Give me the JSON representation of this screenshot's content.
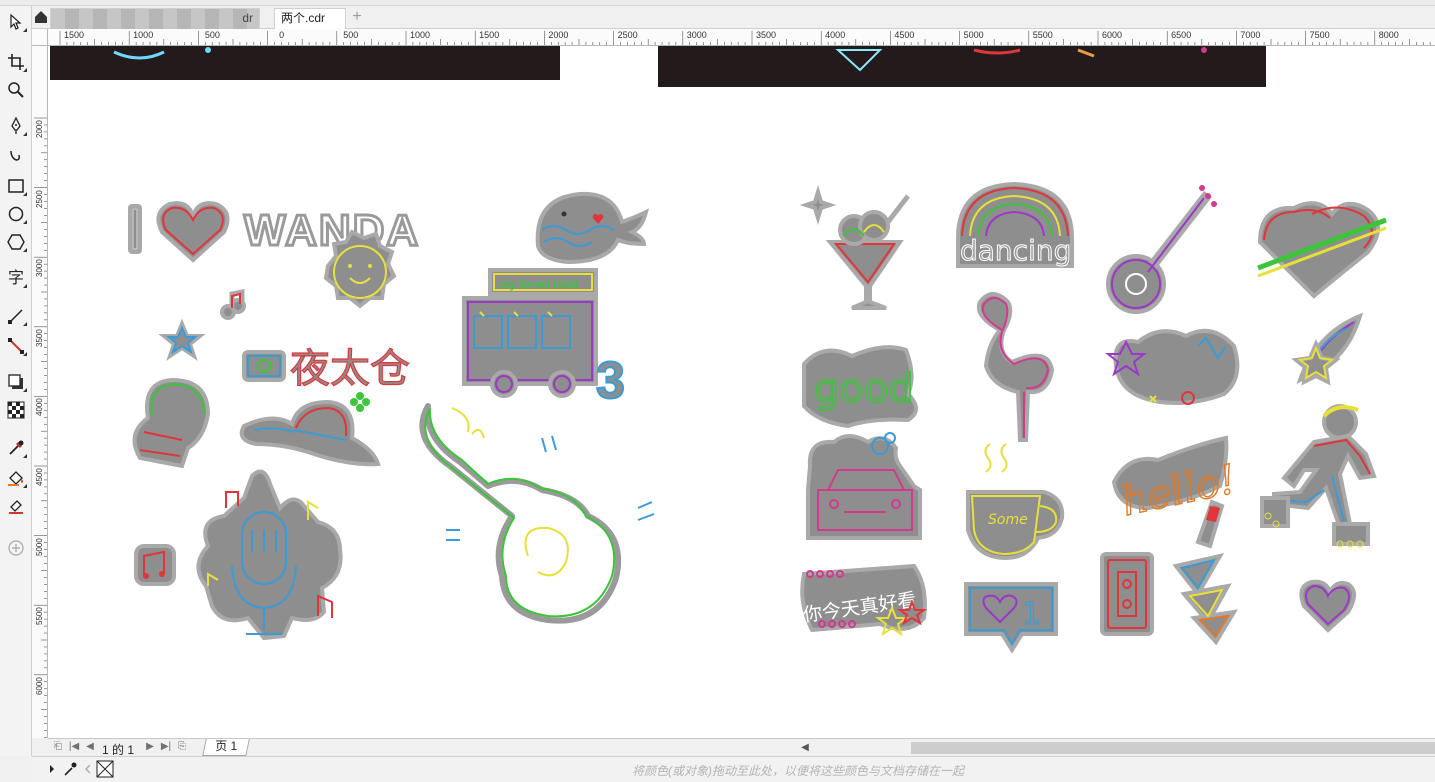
{
  "tabs": [
    {
      "label": "dr",
      "active": false,
      "blurred": true
    },
    {
      "label": "两个.cdr",
      "active": true,
      "blurred": false
    }
  ],
  "tab_add_label": "+",
  "ruler": {
    "h_labels": [
      "1500",
      "1000",
      "500",
      "0",
      "500",
      "1000",
      "1500",
      "2000",
      "2500",
      "3000",
      "3500",
      "4000",
      "4500",
      "5000",
      "5500",
      "6000",
      "6500",
      "7000",
      "7500",
      "8000"
    ],
    "v_labels": [
      "2000",
      "2500",
      "3000",
      "3500",
      "4000",
      "4500",
      "5000",
      "5500",
      "6000"
    ]
  },
  "canvas": {
    "wanda_text": "WANDA",
    "i_text": "I",
    "bus_sign": "my Street Hold",
    "ye_tai_cang": "夜太仓",
    "dancing_text": "dancing",
    "good_text": "good",
    "hello_text": "hello!",
    "some_text": "Some",
    "sticker_text": "你今天真好看",
    "like_count": "1",
    "bus_number": "3"
  },
  "page_nav": {
    "page_count": "1 的 1",
    "page_tab": "页 1"
  },
  "status": {
    "hint": "将颜色(或对象)拖动至此处，以便将这些颜色与文档存储在一起"
  },
  "colors": {
    "neon_red": "#e0353a",
    "neon_yellow": "#e8e03a",
    "neon_blue": "#3a9bd6",
    "neon_green": "#3cc43a",
    "neon_purple": "#9b38c8",
    "neon_pink": "#d23a8e",
    "neon_orange": "#e07a2a",
    "sticker_gray": "#8e8e8e",
    "dark_band": "#231a1b"
  },
  "icons": [
    "home-icon",
    "select-tool-icon",
    "crop-tool-icon",
    "zoom-tool-icon",
    "pen-tool-icon",
    "curve-tool-icon",
    "rectangle-tool-icon",
    "ellipse-tool-icon",
    "polygon-tool-icon",
    "text-tool-icon",
    "line-tool-icon",
    "connector-tool-icon",
    "shadow-tool-icon",
    "transparency-tool-icon",
    "eyedropper-tool-icon",
    "fill-tool-icon",
    "smart-fill-tool-icon",
    "add-tool-icon"
  ]
}
